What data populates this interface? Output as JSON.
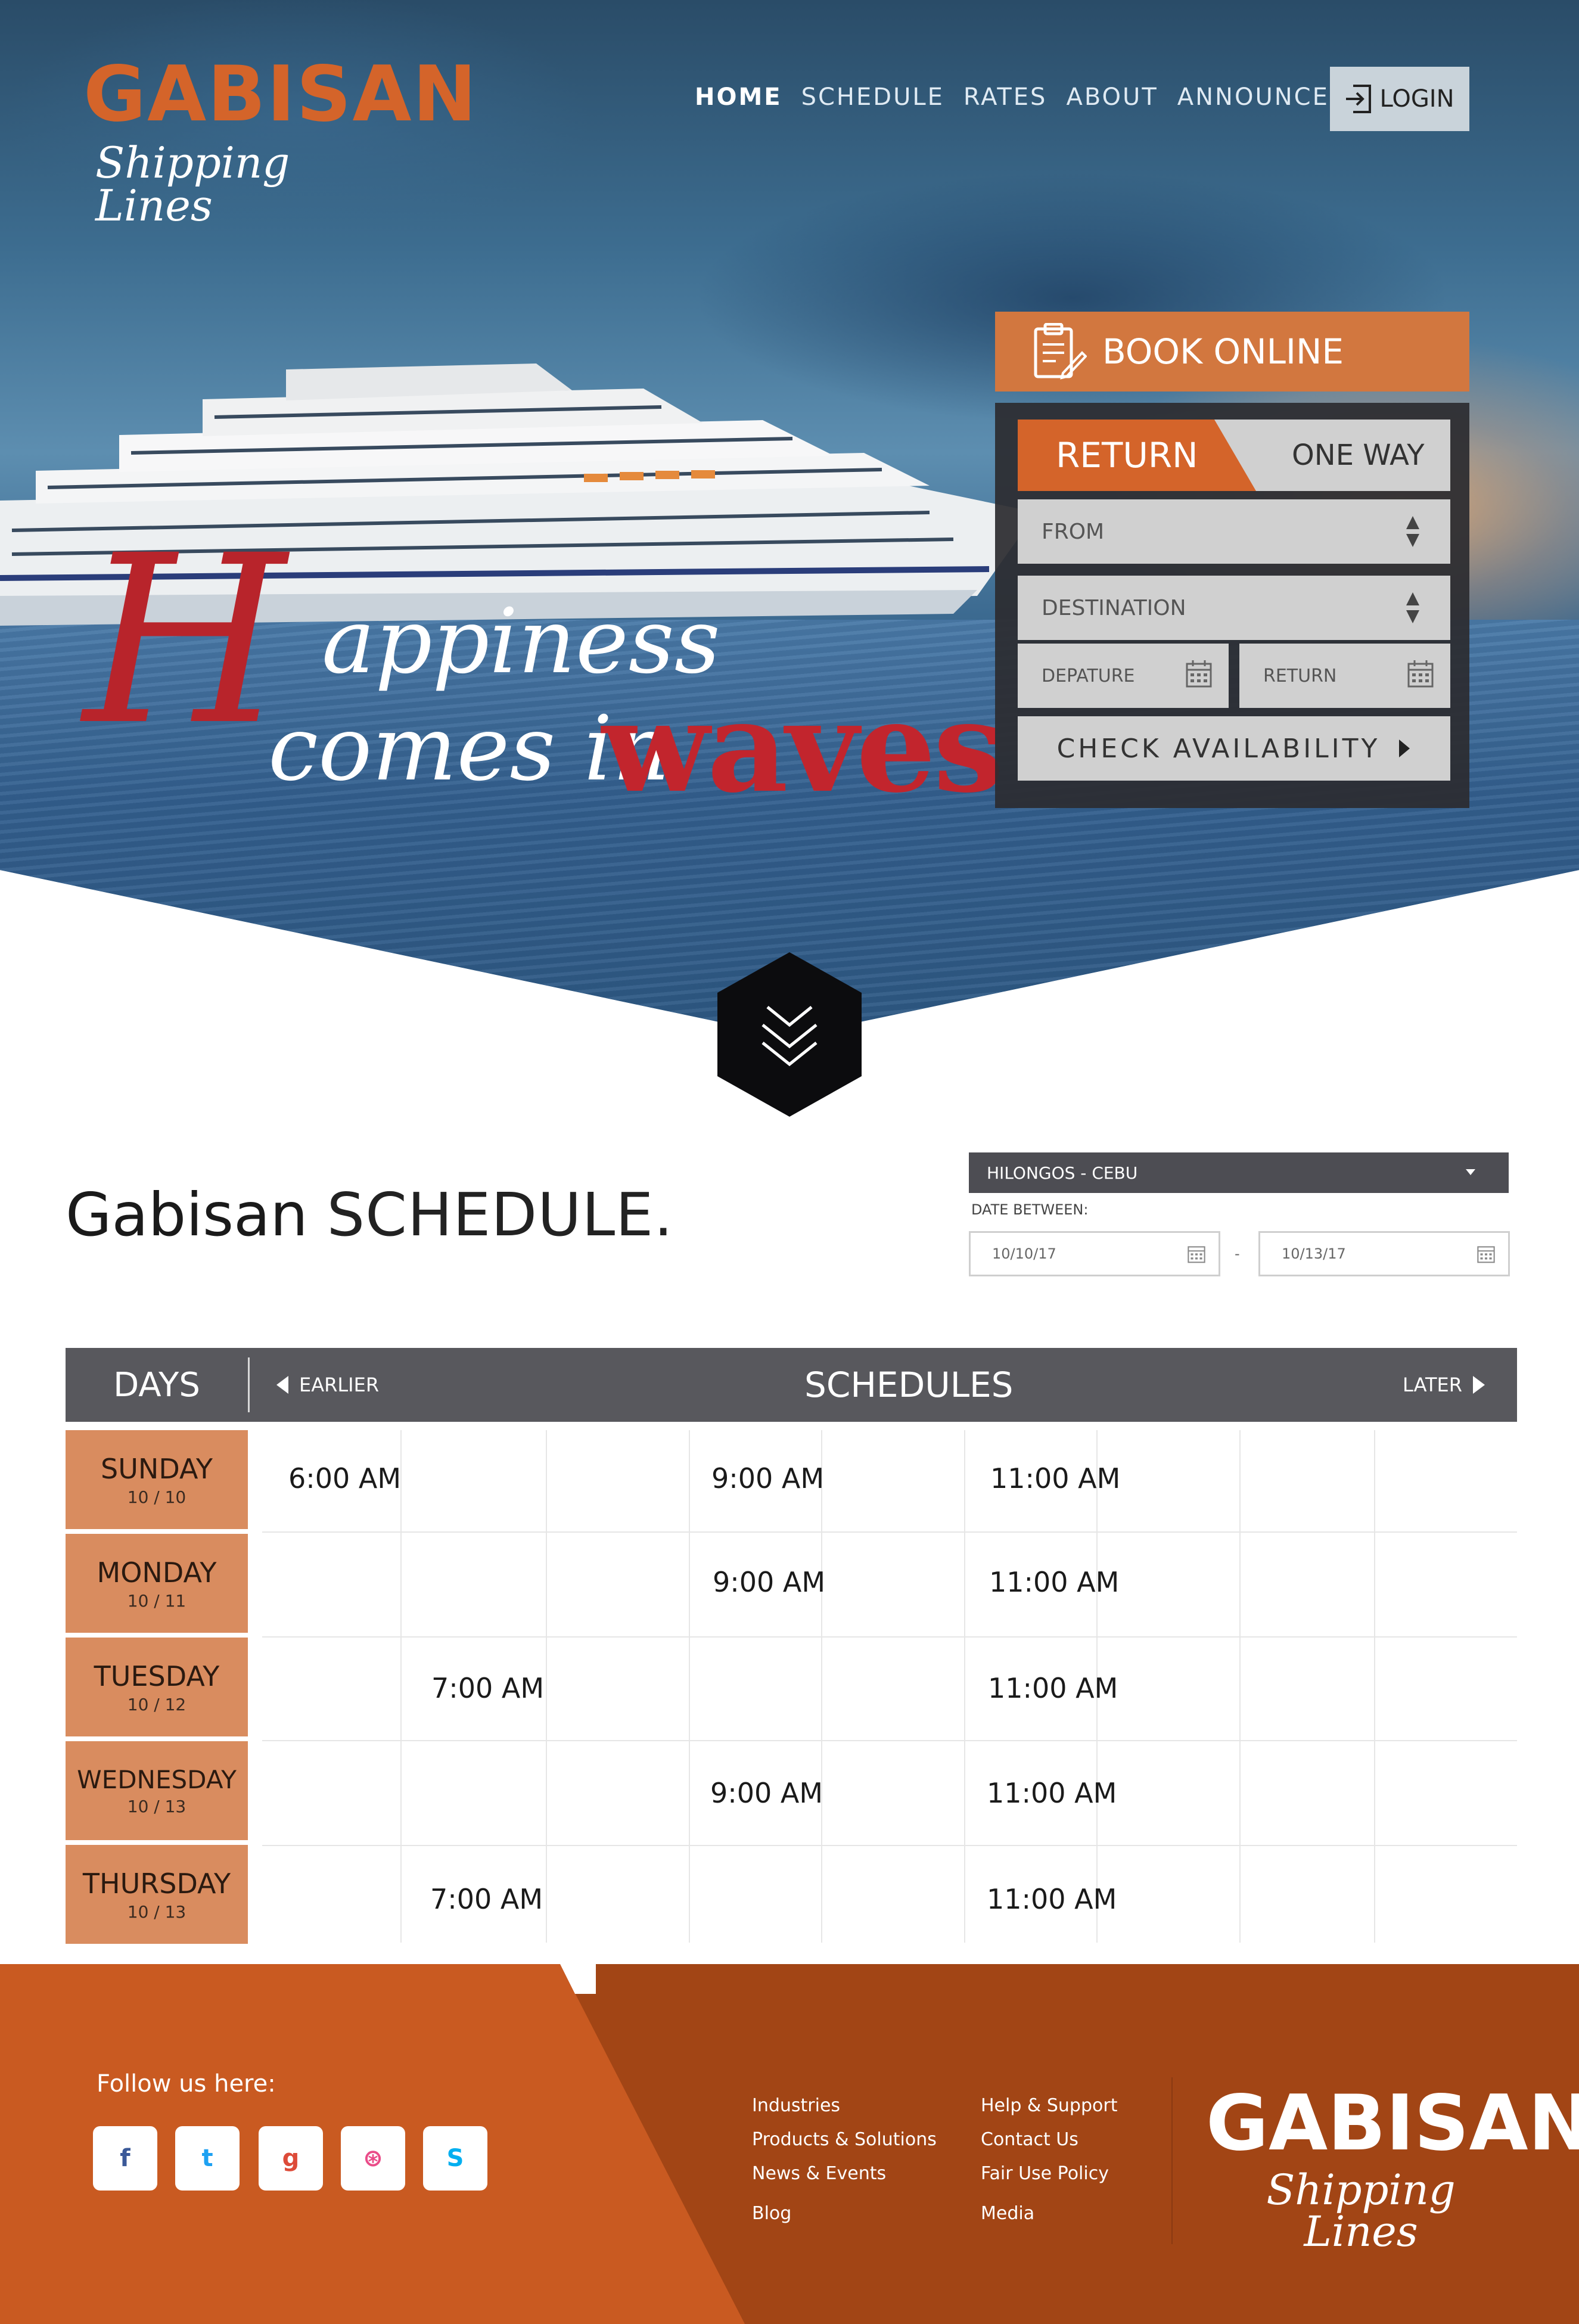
{
  "brand": {
    "name": "GABISAN",
    "subtitle": "Shipping Lines"
  },
  "nav": {
    "home": "HOME",
    "schedule": "SCHEDULE",
    "rates": "RATES",
    "about": "ABOUT",
    "announcement": "ANNOUNCEMENT",
    "login": "LOGIN"
  },
  "hero": {
    "tag_initial": "H",
    "tag_line1": "appiness",
    "tag_line2": "comes in",
    "tag_emph": "waves"
  },
  "booking": {
    "title": "BOOK ONLINE",
    "tab_return": "RETURN",
    "tab_oneway": "ONE WAY",
    "from_placeholder": "FROM",
    "destination_placeholder": "DESTINATION",
    "depart_placeholder": "DEPATURE",
    "return_placeholder": "RETURN",
    "check_label": "CHECK AVAILABILITY"
  },
  "schedule": {
    "title_bold": "Gabisan",
    "title_thin": "SCHEDULE.",
    "route": "HILONGOS - CEBU",
    "date_label": "DATE BETWEEN:",
    "date_from": "10/10/17",
    "date_sep": "-",
    "date_to": "10/13/17",
    "head_days": "DAYS",
    "head_earlier": "EARLIER",
    "head_schedules": "SCHEDULES",
    "head_later": "LATER",
    "days": [
      {
        "name": "SUNDAY",
        "date": "10 / 10"
      },
      {
        "name": "MONDAY",
        "date": "10 / 11"
      },
      {
        "name": "TUESDAY",
        "date": "10 / 12"
      },
      {
        "name": "WEDNESDAY",
        "date": "10 / 13"
      },
      {
        "name": "THURSDAY",
        "date": "10 / 13"
      }
    ],
    "times": {
      "sun_a": "6:00 AM",
      "sun_b": "9:00 AM",
      "sun_c": "11:00 AM",
      "mon_b": "9:00 AM",
      "mon_c": "11:00 AM",
      "tue_a": "7:00 AM",
      "tue_c": "11:00 AM",
      "wed_b": "9:00 AM",
      "wed_c": "11:00 AM",
      "thu_a": "7:00 AM",
      "thu_c": "11:00 AM"
    }
  },
  "footer": {
    "follow": "Follow us here:",
    "social": [
      {
        "name": "facebook",
        "glyph": "f",
        "color": "#3b5998"
      },
      {
        "name": "twitter",
        "glyph": "t",
        "color": "#1da1f2"
      },
      {
        "name": "google-plus",
        "glyph": "g",
        "color": "#dd4b39"
      },
      {
        "name": "dribbble",
        "glyph": "⊛",
        "color": "#ea4c89"
      },
      {
        "name": "skype",
        "glyph": "S",
        "color": "#00aff0"
      }
    ],
    "links_col1": [
      "Industries",
      "Products & Solutions",
      "News & Events",
      "Blog"
    ],
    "links_col2": [
      "Help & Support",
      "Contact Us",
      "Fair Use Policy",
      "Media"
    ]
  }
}
